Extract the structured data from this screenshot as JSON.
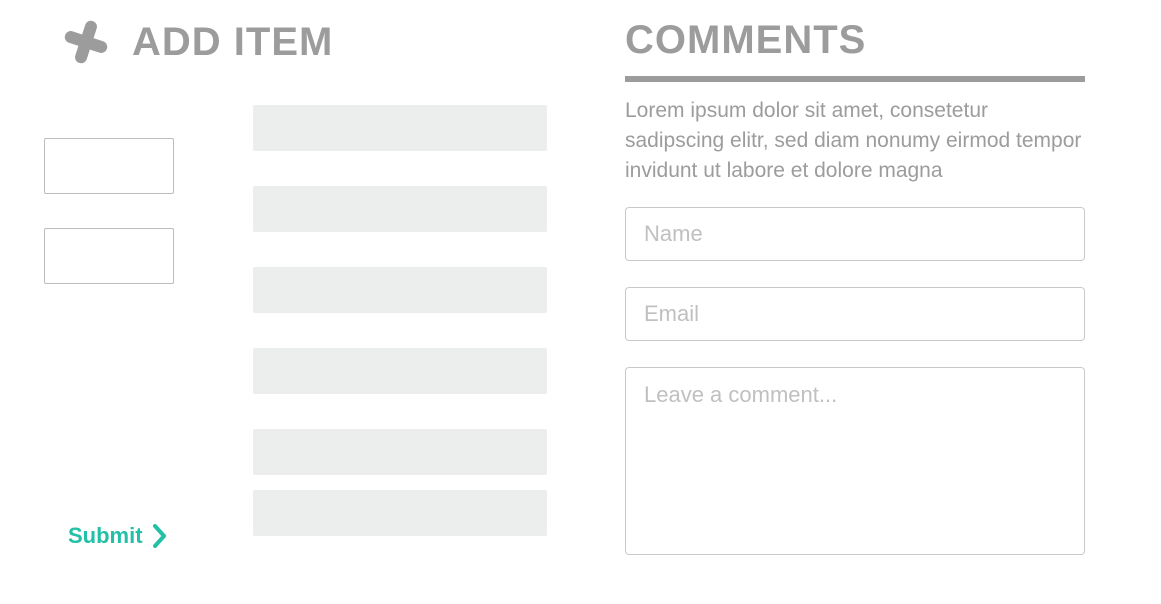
{
  "add_item": {
    "title": "ADD ITEM",
    "submit_label": "Submit"
  },
  "comments": {
    "title": "COMMENTS",
    "description": "Lorem ipsum dolor sit amet, consetetur sadipscing elitr, sed diam nonumy eirmod tempor invidunt ut labore et dolore magna",
    "name_placeholder": "Name",
    "email_placeholder": "Email",
    "body_placeholder": "Leave a comment..."
  },
  "colors": {
    "gray_text": "#9c9c9c",
    "block_fill": "#eceded",
    "accent": "#21c0a7",
    "border": "#c9c9c9"
  }
}
